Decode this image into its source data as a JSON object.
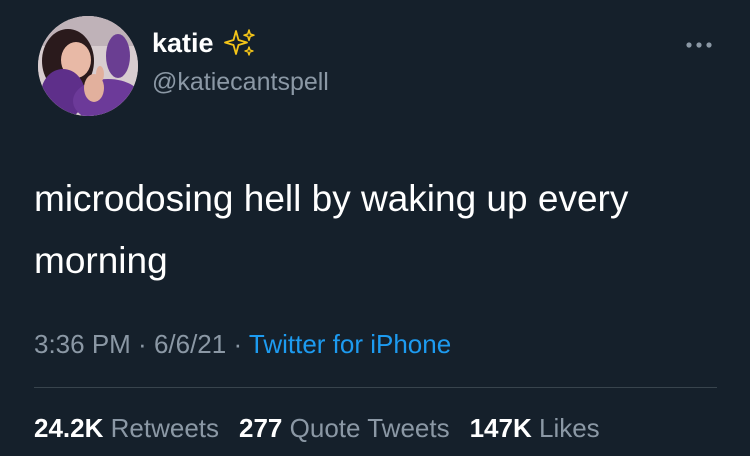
{
  "user": {
    "display_name": "katie",
    "name_emoji_icon": "sparkles-icon",
    "handle": "@katiecantspell",
    "avatar_icon": "avatar"
  },
  "tweet": {
    "text": "microdosing hell by waking up every morning"
  },
  "meta": {
    "time": "3:36 PM",
    "separator1": " · ",
    "date": "6/6/21",
    "separator2": " · ",
    "source": "Twitter for iPhone"
  },
  "stats": {
    "retweets_count": "24.2K",
    "retweets_label": "Retweets",
    "quotes_count": "277",
    "quotes_label": "Quote Tweets",
    "likes_count": "147K",
    "likes_label": "Likes"
  },
  "colors": {
    "background": "#15202b",
    "text_primary": "#ffffff",
    "text_secondary": "#8b98a5",
    "link": "#1d9bf0",
    "divider": "#38444d"
  },
  "icons": {
    "more": "more-horizontal-icon",
    "sparkles": "sparkles-icon"
  }
}
